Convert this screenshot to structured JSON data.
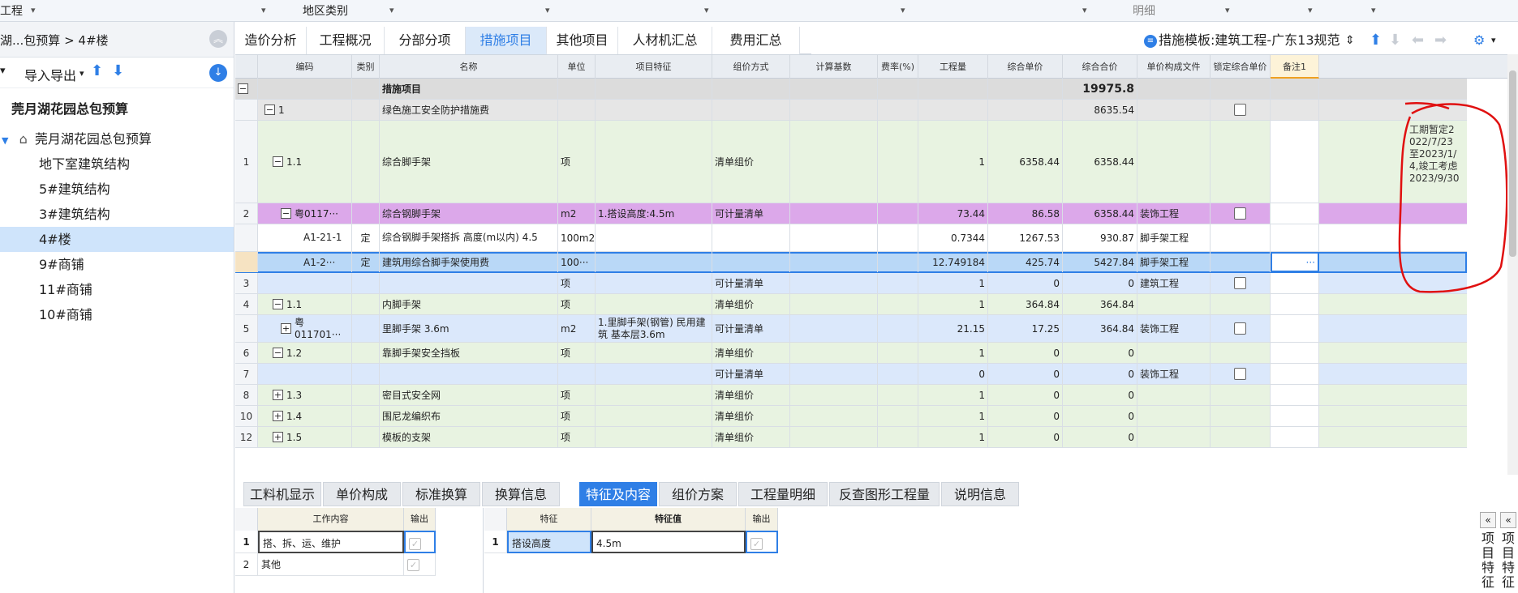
{
  "top": {
    "a": "工程",
    "b": "地区类别",
    "c": "明细"
  },
  "left": {
    "breadcrumb": "湖...包预算 > 4#楼",
    "tool": {
      "import_export": "导入导出"
    },
    "root": "莞月湖花园总包预算",
    "sub": "莞月湖花园总包预算",
    "items": [
      "地下室建筑结构",
      "5#建筑结构",
      "3#建筑结构",
      "4#楼",
      "9#商铺",
      "11#商铺",
      "10#商铺"
    ]
  },
  "tabs": [
    "造价分析",
    "工程概况",
    "分部分项",
    "措施项目",
    "其他项目",
    "人材机汇总",
    "费用汇总"
  ],
  "template": "措施模板:建筑工程-广东13规范",
  "columns": [
    "编码",
    "类别",
    "名称",
    "单位",
    "项目特征",
    "组价方式",
    "计算基数",
    "费率(%)",
    "工程量",
    "综合单价",
    "综合合价",
    "单价构成文件",
    "锁定综合单价",
    "备注1"
  ],
  "rows": [
    {
      "rn": "",
      "code": "",
      "type": "",
      "name": "措施项目",
      "unit": "",
      "feat": "",
      "method": "",
      "base": "",
      "rate": "",
      "qty": "",
      "price": "",
      "total": "19975.8",
      "file": "",
      "note": ""
    },
    {
      "rn": "",
      "code": "1",
      "type": "",
      "name": "绿色施工安全防护措施费",
      "unit": "",
      "feat": "",
      "method": "",
      "base": "",
      "rate": "",
      "qty": "",
      "price": "",
      "total": "8635.54",
      "file": "",
      "note": ""
    },
    {
      "rn": "1",
      "code": "1.1",
      "type": "",
      "name": "综合脚手架",
      "unit": "项",
      "feat": "",
      "method": "清单组价",
      "base": "",
      "rate": "",
      "qty": "1",
      "price": "6358.44",
      "total": "6358.44",
      "file": "",
      "note": "工期暂定2022/7/23至2023/1/4,竣工考虑2023/9/30"
    },
    {
      "rn": "2",
      "code": "粤0117···",
      "type": "",
      "name": "综合钢脚手架",
      "unit": "m2",
      "feat": "1.搭设高度:4.5m",
      "method": "可计量清单",
      "base": "",
      "rate": "",
      "qty": "73.44",
      "price": "86.58",
      "total": "6358.44",
      "file": "装饰工程",
      "note": ""
    },
    {
      "rn": "",
      "code": "A1-21-1",
      "type": "定",
      "name": "综合钢脚手架搭拆 高度(m以内) 4.5",
      "unit": "100m2",
      "feat": "",
      "method": "",
      "base": "",
      "rate": "",
      "qty": "0.7344",
      "price": "1267.53",
      "total": "930.87",
      "file": "脚手架工程",
      "note": ""
    },
    {
      "rn": "",
      "code": "A1-2···",
      "type": "定",
      "name": "建筑用综合脚手架使用费",
      "unit": "100···",
      "feat": "",
      "method": "",
      "base": "",
      "rate": "",
      "qty": "12.749184",
      "price": "425.74",
      "total": "5427.84",
      "file": "脚手架工程",
      "note": "···"
    },
    {
      "rn": "3",
      "code": "",
      "type": "",
      "name": "",
      "unit": "项",
      "feat": "",
      "method": "可计量清单",
      "base": "",
      "rate": "",
      "qty": "1",
      "price": "0",
      "total": "0",
      "file": "建筑工程",
      "note": ""
    },
    {
      "rn": "4",
      "code": "1.1",
      "type": "",
      "name": "内脚手架",
      "unit": "项",
      "feat": "",
      "method": "清单组价",
      "base": "",
      "rate": "",
      "qty": "1",
      "price": "364.84",
      "total": "364.84",
      "file": "",
      "note": ""
    },
    {
      "rn": "5",
      "code": "粤011701···",
      "type": "",
      "name": "里脚手架 3.6m",
      "unit": "m2",
      "feat": "1.里脚手架(钢管) 民用建筑 基本层3.6m",
      "method": "可计量清单",
      "base": "",
      "rate": "",
      "qty": "21.15",
      "price": "17.25",
      "total": "364.84",
      "file": "装饰工程",
      "note": ""
    },
    {
      "rn": "6",
      "code": "1.2",
      "type": "",
      "name": "靠脚手架安全挡板",
      "unit": "项",
      "feat": "",
      "method": "清单组价",
      "base": "",
      "rate": "",
      "qty": "1",
      "price": "0",
      "total": "0",
      "file": "",
      "note": ""
    },
    {
      "rn": "7",
      "code": "",
      "type": "",
      "name": "",
      "unit": "",
      "feat": "",
      "method": "可计量清单",
      "base": "",
      "rate": "",
      "qty": "0",
      "price": "0",
      "total": "0",
      "file": "装饰工程",
      "note": ""
    },
    {
      "rn": "8",
      "code": "1.3",
      "type": "",
      "name": "密目式安全网",
      "unit": "项",
      "feat": "",
      "method": "清单组价",
      "base": "",
      "rate": "",
      "qty": "1",
      "price": "0",
      "total": "0",
      "file": "",
      "note": ""
    },
    {
      "rn": "10",
      "code": "1.4",
      "type": "",
      "name": "围尼龙编织布",
      "unit": "项",
      "feat": "",
      "method": "清单组价",
      "base": "",
      "rate": "",
      "qty": "1",
      "price": "0",
      "total": "0",
      "file": "",
      "note": ""
    },
    {
      "rn": "12",
      "code": "1.5",
      "type": "",
      "name": "模板的支架",
      "unit": "项",
      "feat": "",
      "method": "清单组价",
      "base": "",
      "rate": "",
      "qty": "1",
      "price": "0",
      "total": "0",
      "file": "",
      "note": ""
    }
  ],
  "bottom_tabs": [
    "工料机显示",
    "单价构成",
    "标准换算",
    "换算信息",
    "特征及内容",
    "组价方案",
    "工程量明细",
    "反查图形工程量",
    "说明信息"
  ],
  "work": {
    "h1": "工作内容",
    "h2": "输出",
    "rows": [
      {
        "n": "1",
        "t": "搭、拆、运、维护"
      },
      {
        "n": "2",
        "t": "其他"
      }
    ]
  },
  "feat": {
    "h1": "特征",
    "h2": "特征值",
    "h3": "输出",
    "rows": [
      {
        "n": "1",
        "k": "搭设高度",
        "v": "4.5m"
      }
    ]
  },
  "side": {
    "v1": "项目特征",
    "v2": "项目特征"
  },
  "colors": {
    "accent": "#2f7fe6",
    "green": "#e8f3e1",
    "purple": "#dca8ea",
    "blue": "#dbe8fb",
    "sel": "#cfe4fb",
    "gray": "#dcdcdc"
  }
}
